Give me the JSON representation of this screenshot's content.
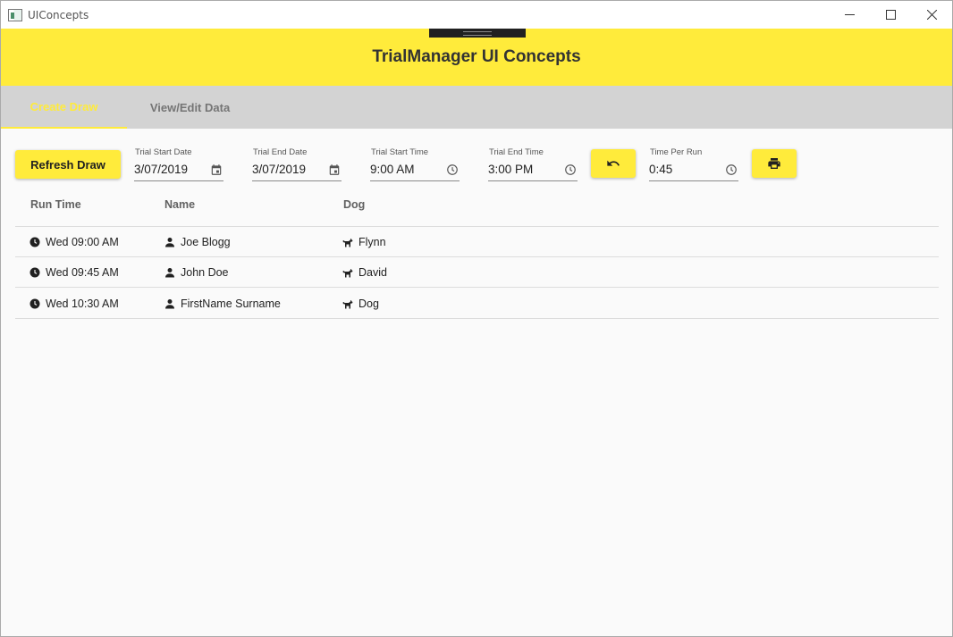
{
  "window": {
    "title": "UIConcepts"
  },
  "header": {
    "title": "TrialManager UI Concepts"
  },
  "tabs": [
    {
      "label": "Create Draw",
      "active": true
    },
    {
      "label": "View/Edit Data",
      "active": false
    }
  ],
  "toolbar": {
    "refresh_label": "Refresh Draw",
    "fields": [
      {
        "label": "Trial Start Date",
        "value": "3/07/2019",
        "icon": "calendar-icon"
      },
      {
        "label": "Trial End Date",
        "value": "3/07/2019",
        "icon": "calendar-icon"
      },
      {
        "label": "Trial Start Time",
        "value": "9:00 AM",
        "icon": "clock-icon"
      },
      {
        "label": "Trial End Time",
        "value": "3:00 PM",
        "icon": "clock-icon"
      },
      {
        "label": "Time Per Run",
        "value": "0:45",
        "icon": "clock-icon"
      }
    ],
    "undo_icon": "undo-icon",
    "print_icon": "print-icon"
  },
  "table": {
    "columns": [
      "Run Time",
      "Name",
      "Dog"
    ],
    "rows": [
      {
        "time": "Wed 09:00 AM",
        "name": "Joe Blogg",
        "dog": "Flynn"
      },
      {
        "time": "Wed 09:45 AM",
        "name": "John Doe",
        "dog": "David"
      },
      {
        "time": "Wed 10:30 AM",
        "name": "FirstName Surname",
        "dog": "Dog"
      }
    ]
  },
  "colors": {
    "accent": "#ffeb3b",
    "tab_bar": "#d3d3d3",
    "text": "#212121"
  }
}
